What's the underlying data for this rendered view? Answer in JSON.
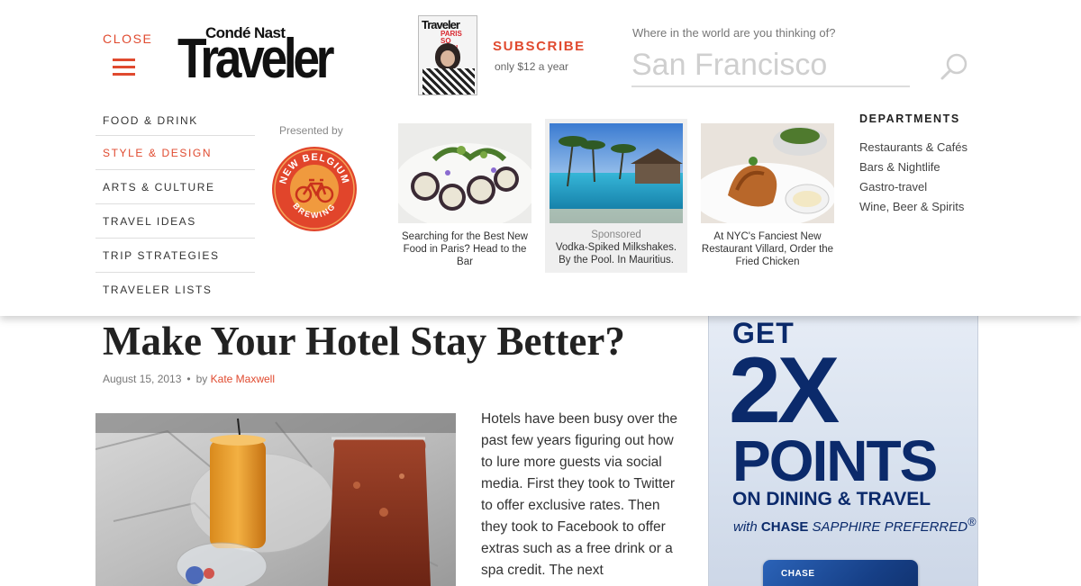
{
  "header": {
    "close_label": "CLOSE",
    "logo_top": "Condé Nast",
    "logo_main": "Traveler",
    "subscribe_label": "SUBSCRIBE",
    "subscribe_price": "only $12 a year",
    "magazine_title": "Traveler",
    "magazine_headline": "PARIS SO POP!"
  },
  "search": {
    "prompt": "Where in the world are you thinking of?",
    "placeholder": "San Francisco"
  },
  "nav": {
    "items": [
      {
        "label": "FOOD & DRINK",
        "active": false
      },
      {
        "label": "STYLE & DESIGN",
        "active": true
      },
      {
        "label": "ARTS & CULTURE",
        "active": false
      },
      {
        "label": "TRAVEL IDEAS",
        "active": false
      },
      {
        "label": "TRIP STRATEGIES",
        "active": false
      },
      {
        "label": "TRAVELER LISTS",
        "active": false
      }
    ]
  },
  "sponsor": {
    "presented_by": "Presented by",
    "top_text": "NEW BELGIUM",
    "bottom_text": "BREWING"
  },
  "stories": [
    {
      "caption": "Searching for the Best New Food in Paris? Head to the Bar"
    },
    {
      "tag": "Sponsored",
      "caption": "Vodka-Spiked Milkshakes. By the Pool. In Mauritius."
    },
    {
      "caption": "At NYC's Fanciest New Restaurant Villard, Order the Fried Chicken"
    }
  ],
  "departments": {
    "title": "DEPARTMENTS",
    "items": [
      "Restaurants & Cafés",
      "Bars & Nightlife",
      "Gastro-travel",
      "Wine, Beer & Spirits"
    ]
  },
  "article": {
    "title_line2": "Make Your Hotel Stay Better?",
    "date": "August 15, 2013",
    "by": "by",
    "author": "Kate Maxwell",
    "body": "Hotels have been busy over the past few years figuring out how to lure more guests via social media. First they took to Twitter to offer exclusive rates. Then they took to Facebook to offer extras such as a free drink or a spa credit. The next"
  },
  "ad": {
    "line1": "GET",
    "line2": "2X",
    "line3": "POINTS",
    "line4": "ON DINING & TRAVEL",
    "with": "with",
    "brand": "CHASE",
    "product": "SAPPHIRE",
    "tier": "PREFERRED",
    "mark": "®",
    "card_label": "CHASE"
  },
  "colors": {
    "accent": "#e04a2f",
    "ad_blue": "#0b2a6b"
  }
}
